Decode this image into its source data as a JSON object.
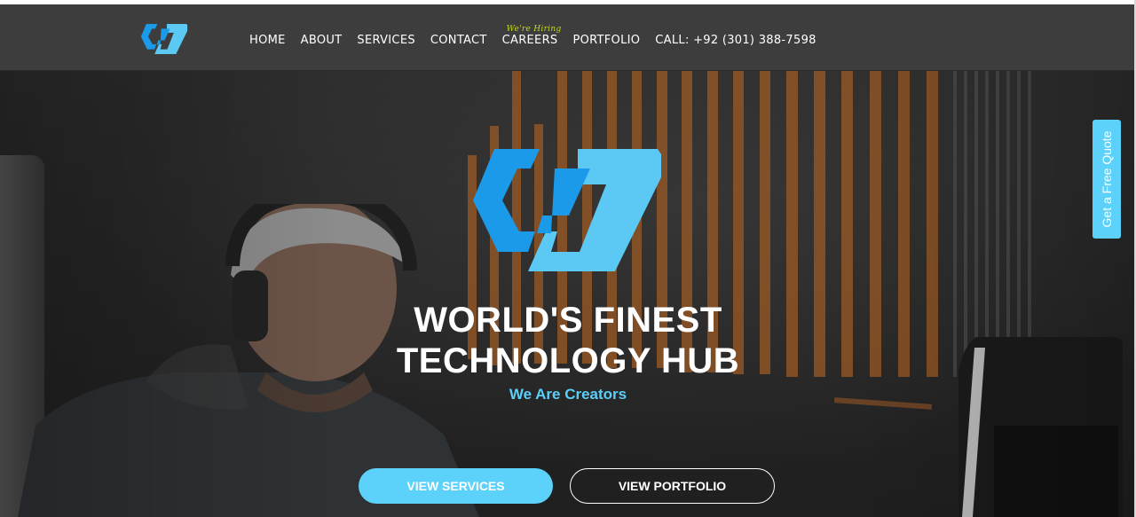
{
  "nav": {
    "links": [
      "HOME",
      "ABOUT",
      "SERVICES",
      "CONTACT",
      "CAREERS",
      "PORTFOLIO"
    ],
    "hiring_badge": "We're Hiring",
    "phone": "CALL: +92 (301) 388-7598"
  },
  "hero": {
    "title_line1": "WORLD'S FINEST",
    "title_line2": "TECHNOLOGY HUB",
    "subtitle": "We Are Creators",
    "primary_button": "VIEW SERVICES",
    "secondary_button": "VIEW PORTFOLIO"
  },
  "quote_tab": "Get a Free Quote",
  "colors": {
    "accent": "#5cd2fa",
    "logo_dark": "#1a9ae8",
    "logo_light": "#5cc9f5",
    "navbar": "#3d3d3d",
    "hiring": "#c6d623",
    "stripes": "#b86a2a"
  },
  "icons": [
    "brand-logo-icon",
    "hero-logo-icon"
  ]
}
